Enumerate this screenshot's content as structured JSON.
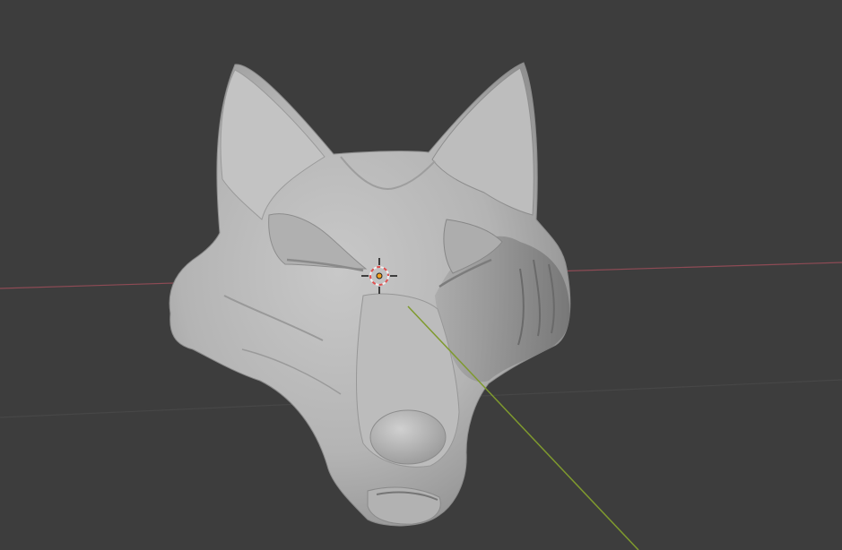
{
  "viewport": {
    "background_color": "#3d3d3d",
    "grid_line_color": "#474747",
    "x_axis_color": "#8e4b55",
    "y_axis_color": "#7f9a2e"
  },
  "object": {
    "kind": "sculpted wolf head mesh",
    "material_color": "#b9b9b9"
  },
  "cursor": {
    "icon": "3d-cursor-icon",
    "ring_colors": [
      "#e05050",
      "#f0f0f0"
    ]
  },
  "origin": {
    "icon": "object-origin-icon",
    "color": "#f0a020"
  }
}
